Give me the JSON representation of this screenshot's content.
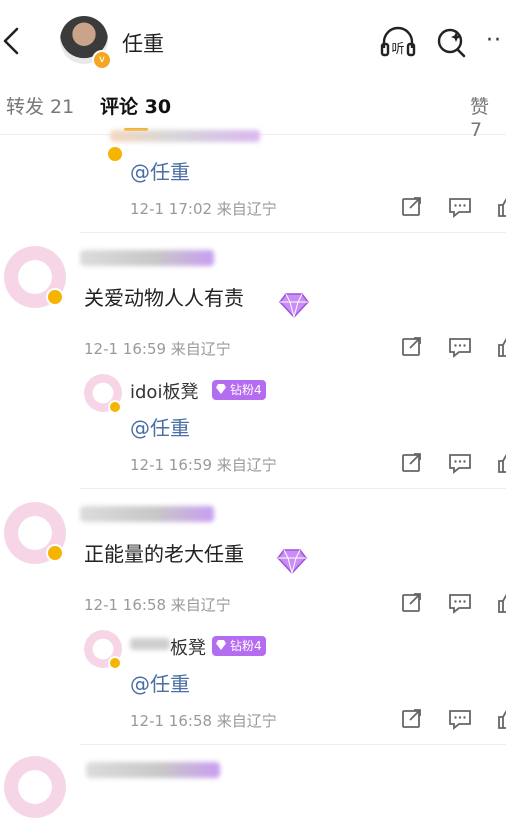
{
  "header": {
    "user_name": "任重",
    "listen_label": "听",
    "more_label": "··"
  },
  "tabs": {
    "repost": "转发 21",
    "comments": "评论 30",
    "likes": "赞 7"
  },
  "comments": [
    {
      "reply_text": "@任重",
      "reply_meta": "12-1 17:02  来自辽宁"
    },
    {
      "text": "关爱动物人人有责",
      "meta": "12-1 16:59  来自辽宁",
      "reply": {
        "user": "idoi板凳",
        "badge": "钻粉4",
        "text": "@任重",
        "meta": "12-1 16:59  来自辽宁"
      }
    },
    {
      "text": "正能量的老大任重",
      "meta": "12-1 16:58  来自辽宁",
      "reply": {
        "user_partial": "板凳",
        "badge": "钻粉4",
        "text": "@任重",
        "meta": "12-1 16:58  来自辽宁"
      }
    }
  ],
  "colors": {
    "accent": "#f7a600",
    "mention": "#4a6fa5",
    "badge": "#b46cf0",
    "vip": "#f5b400"
  },
  "icons": [
    "back-icon",
    "headphones-icon",
    "search-sparkle-icon",
    "share-icon",
    "comment-icon",
    "like-icon",
    "diamond-icon",
    "verified-icon"
  ]
}
